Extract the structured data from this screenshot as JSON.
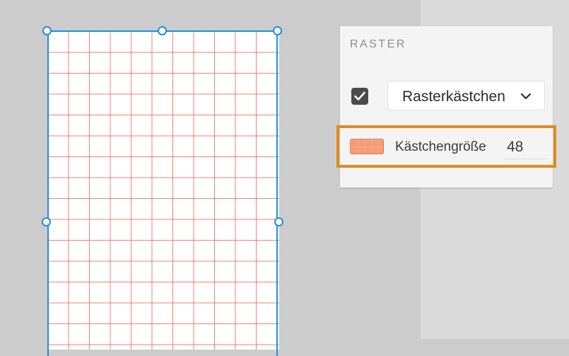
{
  "panel": {
    "title": "RASTER",
    "grid_enabled": true,
    "grid_type_dropdown": {
      "selected": "Rasterkästchen",
      "icon": "chevron-down-icon"
    },
    "grid_color_swatch": {
      "color": "#f59b74",
      "icon": "color-swatch"
    },
    "grid_size": {
      "label": "Kästchengröße",
      "value": "48"
    }
  },
  "artboard": {
    "grid_color": "#eb5a3c",
    "selection_color": "#1e8fe0"
  },
  "highlight_color": "#e38a1e"
}
